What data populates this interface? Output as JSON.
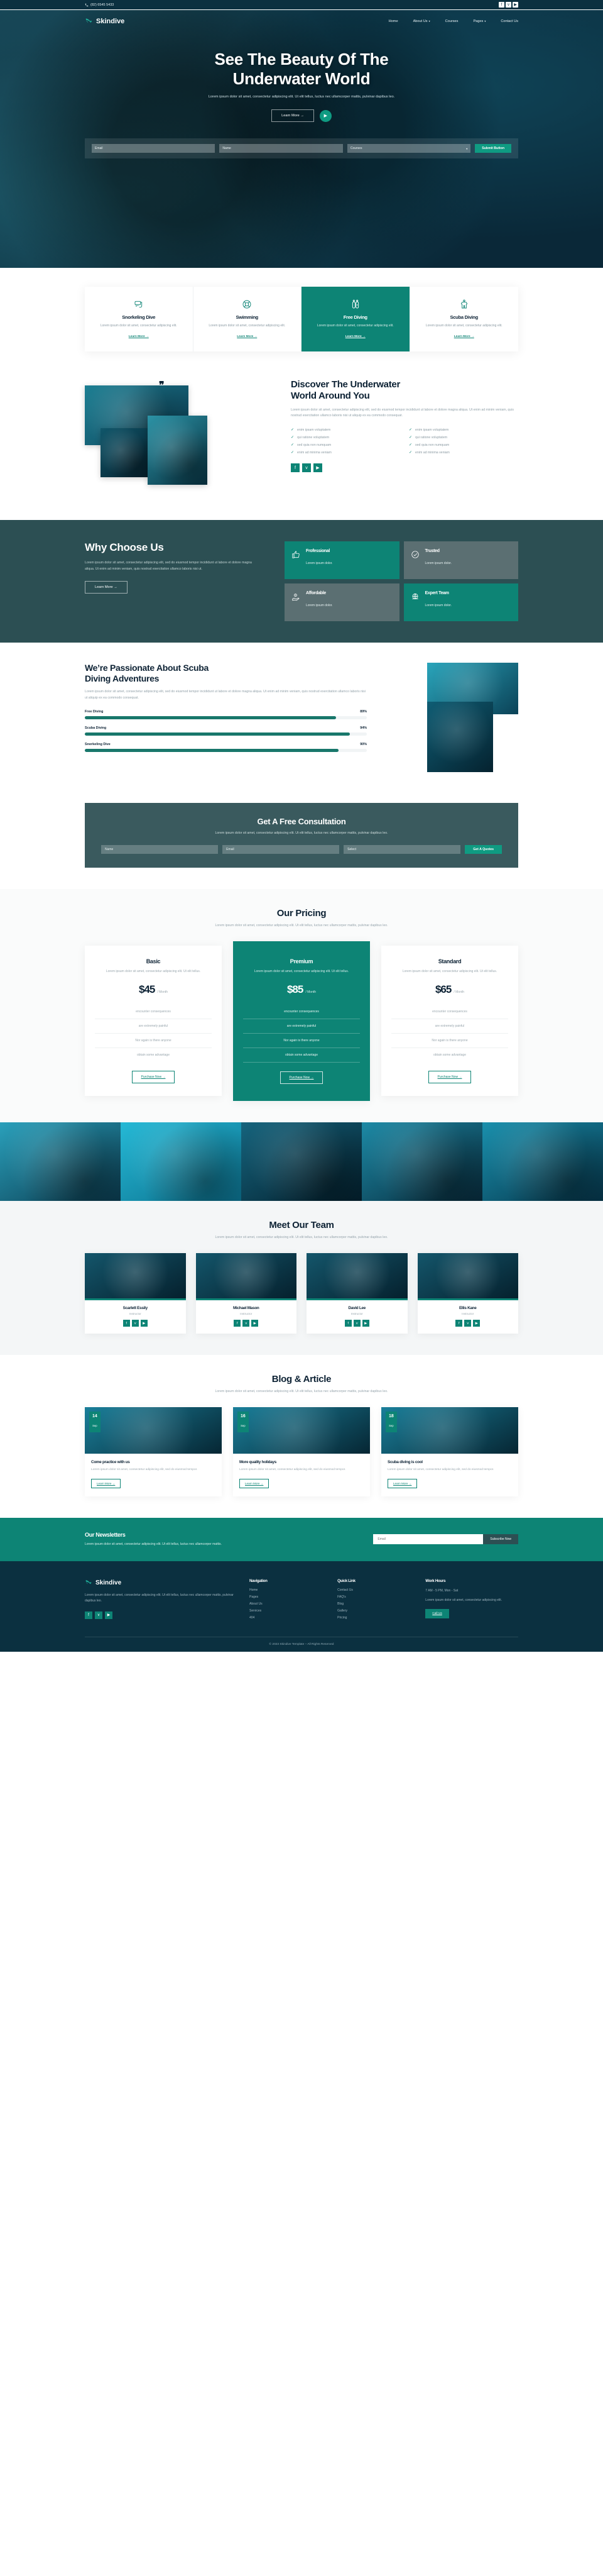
{
  "brand": {
    "name": "Skindive",
    "logo_icon": "shark-fin-icon"
  },
  "topbar": {
    "phone": "(82) 6545 5433",
    "phone_icon": "phone-icon",
    "socials": [
      {
        "name": "facebook-icon",
        "glyph": "f"
      },
      {
        "name": "twitter-icon",
        "glyph": "ᴠ"
      },
      {
        "name": "youtube-icon",
        "glyph": "▶"
      }
    ]
  },
  "nav": {
    "items": [
      {
        "label": "Home",
        "caret": false
      },
      {
        "label": "About Us",
        "caret": true
      },
      {
        "label": "Courses",
        "caret": false
      },
      {
        "label": "Pages",
        "caret": true
      },
      {
        "label": "Contact Us",
        "caret": false
      }
    ]
  },
  "hero": {
    "title_line1": "See The Beauty Of The",
    "title_line2": "Underwater World",
    "subtitle": "Lorem ipsum dolor sit amet, consectetur adipiscing elit. Ut elit tellus, luctus nec ullamcorper mattis, pulvinar dapibus leo.",
    "cta": "Learn More →",
    "play_icon": "play-icon"
  },
  "bookbar": {
    "email_placeholder": "Email",
    "name_placeholder": "Name",
    "course_value": "Courses",
    "submit": "Submit Button"
  },
  "services": {
    "items": [
      {
        "icon": "snorkel-mask-icon",
        "title": "Snorkeling Dive",
        "desc": "Lorem ipsum dolor sit amet, consectetur adipiscing elit.",
        "link": "Learn More →",
        "active": false
      },
      {
        "icon": "life-ring-icon",
        "title": "Swimming",
        "desc": "Lorem ipsum dolor sit amet, consectetur adipiscing elit.",
        "link": "Learn More →",
        "active": false
      },
      {
        "icon": "oxygen-tank-icon",
        "title": "Free Diving",
        "desc": "Lorem ipsum dolor sit amet, consectetur adipiscing elit.",
        "link": "Learn More →",
        "active": true
      },
      {
        "icon": "wetsuit-icon",
        "title": "Scuba Diving",
        "desc": "Lorem ipsum dolor sit amet, consectetur adipiscing elit.",
        "link": "Learn More →",
        "active": false
      }
    ]
  },
  "discover": {
    "title_line1": "Discover The Underwater",
    "title_line2": "World Around You",
    "lead": "Lorem ipsum dolor sit amet, consectetur adipiscing elit, sed do eiusmod tempor incididunt ut labore et dolore magna aliqua. Ut enim ad minim veniam, quis nostrud exercitation ullamco laboris nisi ut aliquip ex ea commodo consequat.",
    "ticks": [
      "enim ipsam voluptatem",
      "enim ipsam voluptatem",
      "qui ratione voluptatem",
      "qui ratione voluptatem",
      "sed quia non numquam",
      "sed quia non numquam",
      "enim ad minima veniam",
      "enim ad minima veniam"
    ],
    "socials": [
      {
        "name": "facebook-icon",
        "glyph": "f"
      },
      {
        "name": "twitter-icon",
        "glyph": "ᴠ"
      },
      {
        "name": "youtube-icon",
        "glyph": "▶"
      }
    ]
  },
  "why": {
    "title": "Why Choose Us",
    "body": "Lorem ipsum dolor sit amet, consectetur adipiscing elit, sed do eiusmod tempor incididunt ut labore et dolore magna aliqua. Ut enim ad minim veniam, quis nostrud exercitation ullamco laboris nisi ut.",
    "cta": "Learn More →",
    "cards": [
      {
        "icon": "thumbs-up-icon",
        "title": "Frofessional",
        "desc": "Lorem ipsum dolor.",
        "highlight": true
      },
      {
        "icon": "check-circle-icon",
        "title": "Trusted",
        "desc": "Lorem ipsum dolor.",
        "highlight": false
      },
      {
        "icon": "hand-coin-icon",
        "title": "Affordable",
        "desc": "Lorem ipsum dolor.",
        "highlight": false
      },
      {
        "icon": "globe-team-icon",
        "title": "Expert Team",
        "desc": "Lorem ipsum dolor.",
        "highlight": true
      }
    ]
  },
  "passionate": {
    "title_line1": "We’re Passionate About Scuba",
    "title_line2": "Diving Adventures",
    "lead": "Lorem ipsum dolor sit amet, consectetur adipiscing elit, sed do eiusmod tempor incididunt ut labore et dolore magna aliqua. Ut enim ad minim veniam, quis nostrud exercitation ullamco laboris nisi ut aliquip ex ea commodo consequat."
  },
  "chart_data": {
    "type": "bar",
    "title": "Diving skill proficiency",
    "categories": [
      "Free Diving",
      "Scuba Diving",
      "Snorkeling Dive"
    ],
    "values": [
      89,
      94,
      90
    ],
    "value_labels": [
      "89%",
      "94%",
      "90%"
    ],
    "xlabel": "",
    "ylabel": "",
    "ylim": [
      0,
      100
    ],
    "grid": false,
    "legend": "none",
    "orientation": "horizontal",
    "bar_color": "#18776b",
    "track_color": "#f1f4f5"
  },
  "consult": {
    "title": "Get A Free Consultation",
    "desc": "Lorem ipsum dolor sit amet, consectetur adipiscing elit. Ut elit tellus, luctus nec ullamcorper mattis, pulvinar dapibus leo.",
    "name_placeholder": "Name",
    "email_placeholder": "Email",
    "select_value": "Select",
    "submit": "Get A Quotes"
  },
  "pricing": {
    "title": "Our Pricing",
    "subtitle": "Lorem ipsum dolor sit amet, consectetur adipiscing elit. Ut elit tellus, luctus nec ullamcorper mattis, pulvinar dapibus leo.",
    "plans": [
      {
        "name": "Basic",
        "desc": "Lorem ipsum dolor sit amet, consectetur adipiscing elit. Ut elit tellus.",
        "price": "$45",
        "period": "/ Month",
        "features": [
          "encounter consequences",
          "are extremely painful",
          "Nor again is there anyone",
          "obtain some advantage"
        ],
        "cta": "Purchase Now →",
        "featured": false
      },
      {
        "name": "Premium",
        "desc": "Lorem ipsum dolor sit amet, consectetur adipiscing elit. Ut elit tellus.",
        "price": "$85",
        "period": "/ Month",
        "features": [
          "encounter consequences",
          "are extremely painful",
          "Nor again is there anyone",
          "obtain some advantage"
        ],
        "cta": "Purchase Now →",
        "featured": true
      },
      {
        "name": "Standard",
        "desc": "Lorem ipsum dolor sit amet, consectetur adipiscing elit. Ut elit tellus.",
        "price": "$65",
        "period": "/ Month",
        "features": [
          "encounter consequences",
          "are extremely painful",
          "Nor again is there anyone",
          "obtain some advantage"
        ],
        "cta": "Purchase Now →",
        "featured": false
      }
    ]
  },
  "team": {
    "title": "Meet Our Team",
    "subtitle": "Lorem ipsum dolor sit amet, consectetur adipiscing elit. Ut elit tellus, luctus nec ullamcorper mattis, pulvinar dapibus leo.",
    "members": [
      {
        "name": "Scarlett Essily",
        "role": "Instructor"
      },
      {
        "name": "Michael Mason",
        "role": "Instructor"
      },
      {
        "name": "David Lee",
        "role": "Instructor"
      },
      {
        "name": "Ellis Kane",
        "role": "Instructor"
      }
    ],
    "socials": [
      {
        "name": "facebook-icon",
        "glyph": "f"
      },
      {
        "name": "twitter-icon",
        "glyph": "ᴠ"
      },
      {
        "name": "youtube-icon",
        "glyph": "▶"
      }
    ]
  },
  "blog": {
    "title": "Blog & Article",
    "subtitle": "Lorem ipsum dolor sit amet, consectetur adipiscing elit. Ut elit tellus, luctus nec ullamcorper mattis, pulvinar dapibus leo.",
    "posts": [
      {
        "day": "14",
        "month": "Sep",
        "title": "Come practice with us",
        "excerpt": "Lorem ipsum dolor sit amet, consectetur adipiscing elit, sed do eiusmod tempor.",
        "cta": "Learn More →"
      },
      {
        "day": "16",
        "month": "Sep",
        "title": "More quality holidays",
        "excerpt": "Lorem ipsum dolor sit amet, consectetur adipiscing elit, sed do eiusmod tempor.",
        "cta": "Learn More →"
      },
      {
        "day": "18",
        "month": "Sep",
        "title": "Scuba diving is cool",
        "excerpt": "Lorem ipsum dolor sit amet, consectetur adipiscing elit, sed do eiusmod tempor.",
        "cta": "Learn More →"
      }
    ]
  },
  "newsletter": {
    "title": "Our Newsletters",
    "desc": "Lorem ipsum dolor sit amet, consectetur adipiscing elit. Ut elit tellus, luctus nec ullamcorper mattis.",
    "placeholder": "Email",
    "button": "Subscribe Now"
  },
  "footer": {
    "about": "Lorem ipsum dolor sit amet, consectetur adipiscing elit. Ut elit tellus, luctus nec ullamcorper mattis, pulvinar dapibus leo.",
    "socials": [
      {
        "name": "facebook-icon",
        "glyph": "f"
      },
      {
        "name": "twitter-icon",
        "glyph": "ᴠ"
      },
      {
        "name": "youtube-icon",
        "glyph": "▶"
      }
    ],
    "columns": [
      {
        "heading": "Navigation",
        "links": [
          "Home",
          "Pages",
          "About Us",
          "Services",
          "404"
        ]
      },
      {
        "heading": "Quick Link",
        "links": [
          "Contact Us",
          "FAQ's",
          "Blog",
          "Gallery",
          "Pricing"
        ]
      }
    ],
    "hours_heading": "Work Hours",
    "hours": "7 AM - 5 PM, Mon - Sat",
    "hours_note": "Lorem ipsum dolor sit amet, consectetur adipiscing elit.",
    "call_button": "Call Us",
    "copyright": "© 2023 Skindive Template – All Rights Reserved"
  },
  "colors": {
    "brand_teal": "#0d8475",
    "dark_navy": "#0b3040",
    "slate": "#2c4f53",
    "accent_green": "#0f9b82"
  }
}
